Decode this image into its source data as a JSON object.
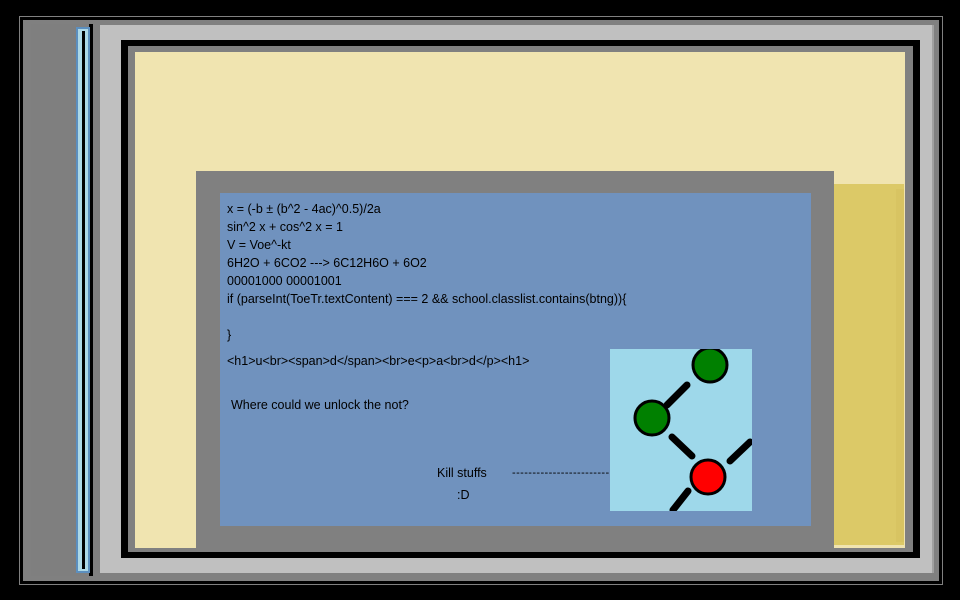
{
  "code_lines": [
    "x = (-b ± (b^2 - 4ac)^0.5)/2a",
    "sin^2 x + cos^2 x = 1",
    "V = Voe^-kt",
    "6H2O + 6CO2 ---> 6C12H6O + 6O2",
    "00001000 00001001",
    "if (parseInt(ToeTr.textContent) === 2 && school.classlist.contains(btng)){",
    "}"
  ],
  "html_snippet": "<h1>u<br><span>d</span><br>e<p>a<br>d</p><h1>",
  "question": "Where could we unlock the not?",
  "hint": {
    "label": "Kill stuffs",
    "arrow": "------------------------------>",
    "smiley": ":D"
  },
  "game": {
    "node_colors": {
      "green": "#008000",
      "red": "#ff0000",
      "outline": "#000000"
    },
    "background": "#9ed8ea"
  }
}
